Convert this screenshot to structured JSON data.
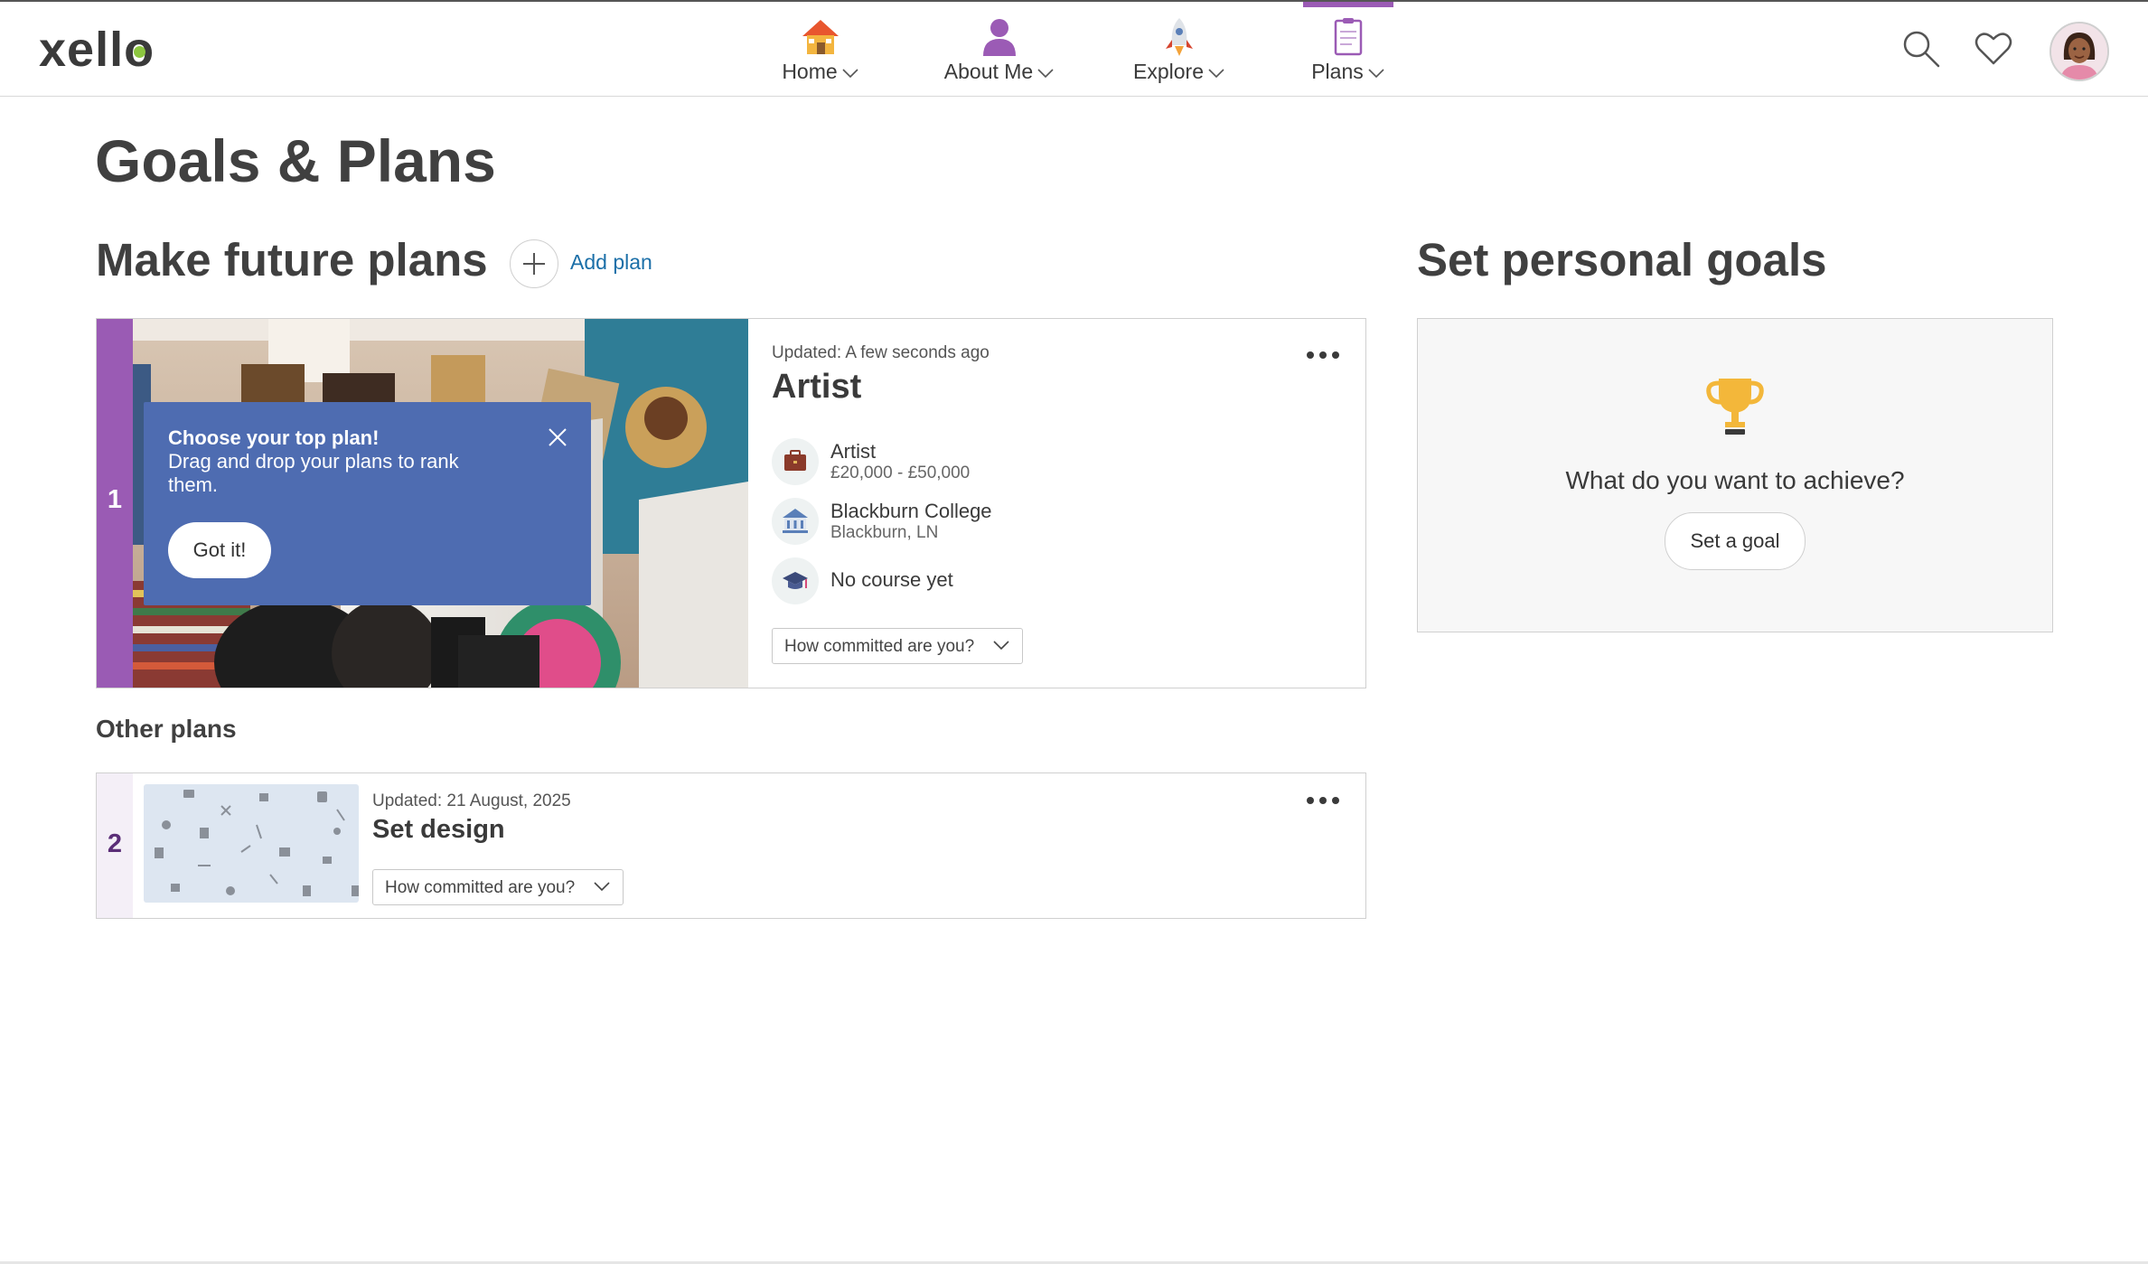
{
  "app": {
    "logo": "xello"
  },
  "nav": {
    "items": [
      {
        "label": "Home",
        "icon": "house-icon"
      },
      {
        "label": "About Me",
        "icon": "person-icon"
      },
      {
        "label": "Explore",
        "icon": "rocket-icon"
      },
      {
        "label": "Plans",
        "icon": "clipboard-icon",
        "active": true
      }
    ],
    "accent": "#9b5bb5"
  },
  "page": {
    "title": "Goals & Plans",
    "plans_heading": "Make future plans",
    "add_plan_label": "Add plan",
    "goals_heading": "Set personal goals",
    "other_plans_heading": "Other plans"
  },
  "top_plan": {
    "rank": "1",
    "updated": "Updated: A few seconds ago",
    "title": "Artist",
    "details": [
      {
        "icon": "briefcase-icon",
        "main": "Artist",
        "sub": "£20,000 - £50,000"
      },
      {
        "icon": "college-icon",
        "main": "Blackburn College",
        "sub": "Blackburn, LN"
      },
      {
        "icon": "graduation-cap-icon",
        "main": "No course yet",
        "sub": ""
      }
    ],
    "commitment_placeholder": "How committed are you?"
  },
  "tooltip": {
    "title": "Choose your top plan!",
    "body": "Drag and drop your plans to rank them.",
    "button": "Got it!"
  },
  "other_plans": [
    {
      "rank": "2",
      "updated": "Updated: 21 August, 2025",
      "title": "Set design",
      "commitment_placeholder": "How committed are you?"
    }
  ],
  "goals": {
    "icon": "trophy-icon",
    "question": "What do you want to achieve?",
    "button": "Set a goal"
  },
  "colors": {
    "rank_bar": "#9a5bb4",
    "tooltip_bg": "#4e6cb1",
    "link": "#1b6fa8"
  }
}
